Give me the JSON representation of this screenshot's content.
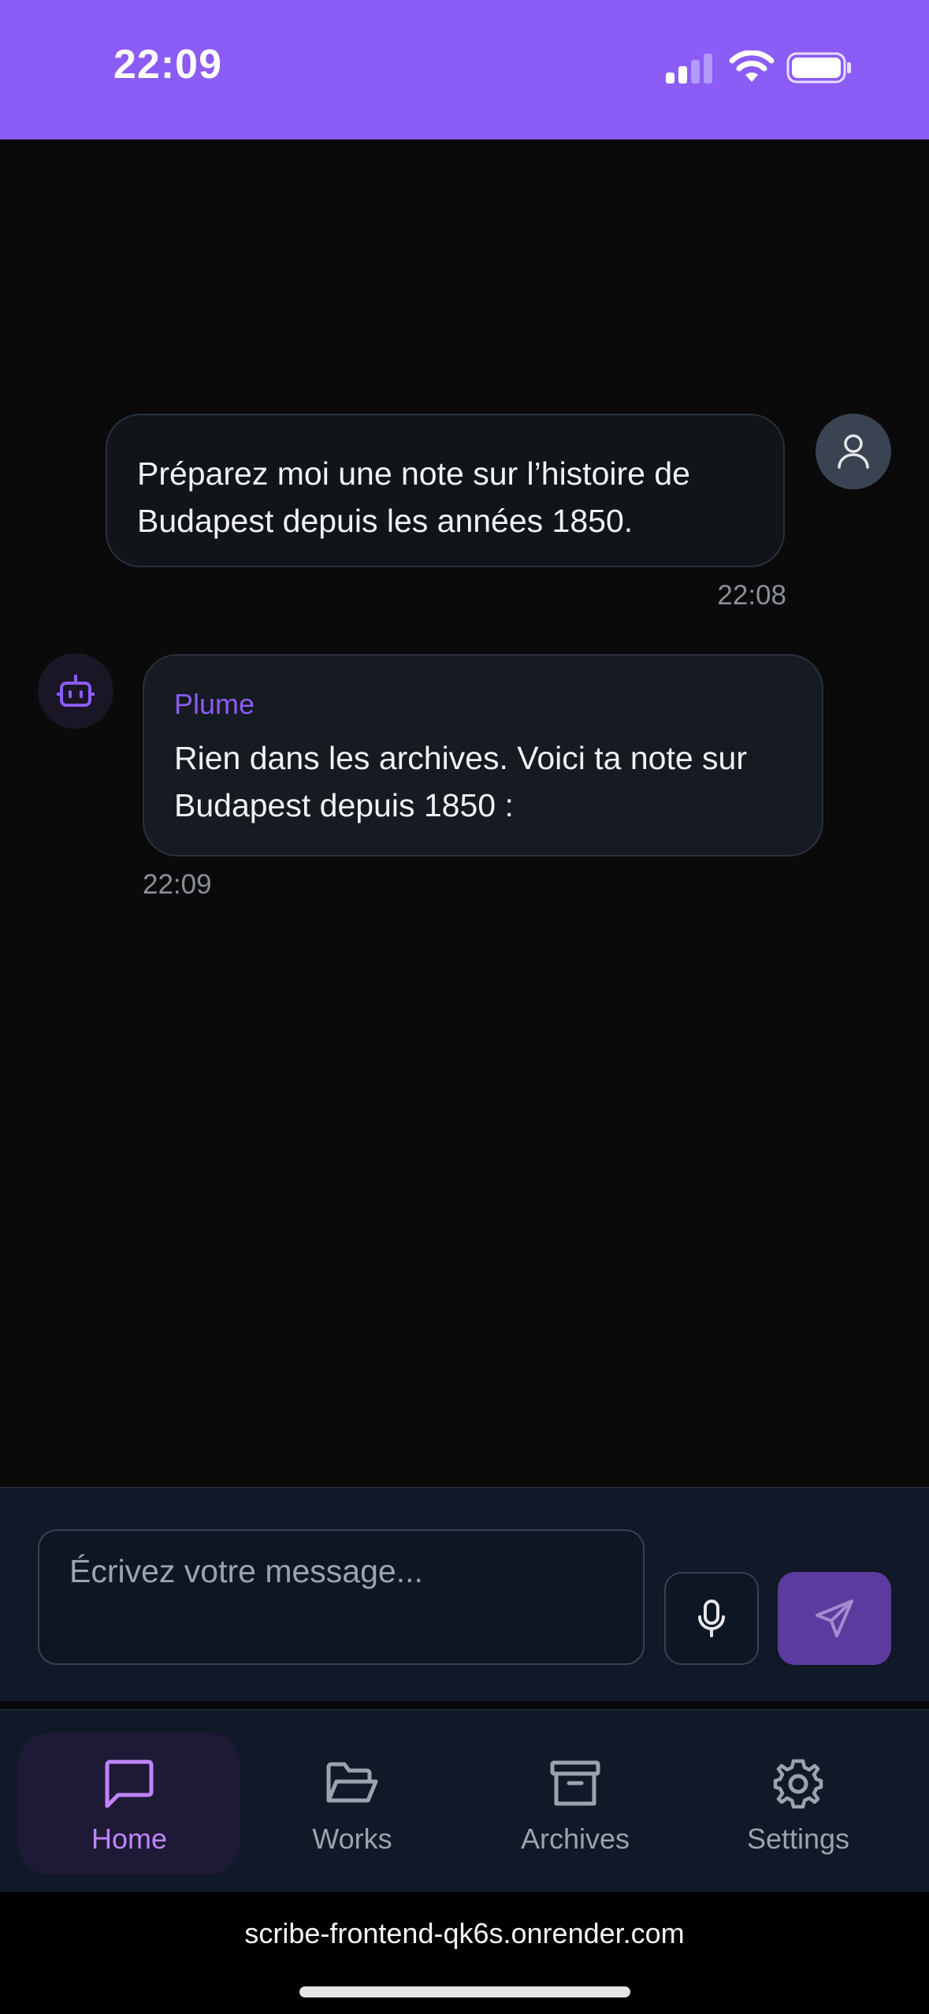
{
  "status_bar": {
    "time": "22:09",
    "icons": [
      "signal-icon",
      "wifi-icon",
      "battery-icon"
    ]
  },
  "chat": {
    "messages": [
      {
        "role": "user",
        "text": "Préparez moi une note sur l’histoire de Budapest depuis les années 1850.",
        "time": "22:08",
        "avatar_icon": "user-icon"
      },
      {
        "role": "assistant",
        "sender": "Plume",
        "text": "Rien dans les archives. Voici ta note sur Budapest depuis 1850 :",
        "time": "22:09",
        "avatar_icon": "bot-icon"
      }
    ]
  },
  "composer": {
    "placeholder": "Écrivez votre message...",
    "mic_icon": "microphone-icon",
    "send_icon": "send-icon"
  },
  "nav": {
    "items": [
      {
        "label": "Home",
        "icon": "message-square-icon",
        "active": true
      },
      {
        "label": "Works",
        "icon": "folder-open-icon",
        "active": false
      },
      {
        "label": "Archives",
        "icon": "archive-icon",
        "active": false
      },
      {
        "label": "Settings",
        "icon": "settings-icon",
        "active": false
      }
    ]
  },
  "browser": {
    "url": "scribe-frontend-qk6s.onrender.com"
  },
  "colors": {
    "accent": "#8b5cf6",
    "background": "#0a0a0a",
    "panel": "#111827",
    "active_nav": "#c084fc"
  }
}
